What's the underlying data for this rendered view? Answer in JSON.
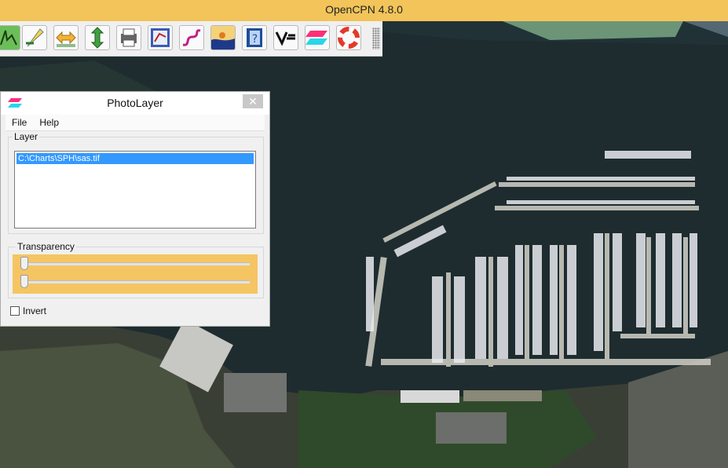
{
  "window": {
    "title": "OpenCPN 4.8.0"
  },
  "toolbar": {
    "buttons": [
      {
        "icon": "route-icon"
      },
      {
        "icon": "compass-icon"
      },
      {
        "icon": "zoom-horizontal-icon"
      },
      {
        "icon": "zoom-vertical-icon"
      },
      {
        "icon": "print-icon"
      },
      {
        "icon": "route-manager-icon"
      },
      {
        "icon": "track-icon"
      },
      {
        "icon": "tide-icon"
      },
      {
        "icon": "help-icon"
      },
      {
        "icon": "dashboard-icon"
      },
      {
        "icon": "photolayer-icon"
      },
      {
        "icon": "lifebuoy-icon"
      }
    ]
  },
  "dialog": {
    "title": "PhotoLayer",
    "close_symbol": "✕",
    "menu": {
      "file": "File",
      "help": "Help"
    },
    "layer_group_label": "Layer",
    "layers": [
      "C:\\Charts\\SPH\\sas.tif"
    ],
    "transparency_label": "Transparency",
    "sliders": [
      {
        "value": 0
      },
      {
        "value": 0
      }
    ],
    "invert_label": "Invert",
    "invert_checked": false
  },
  "colors": {
    "titlebar": "#f2c45a",
    "selection": "#3399ff",
    "slider_panel": "#f5c563"
  }
}
